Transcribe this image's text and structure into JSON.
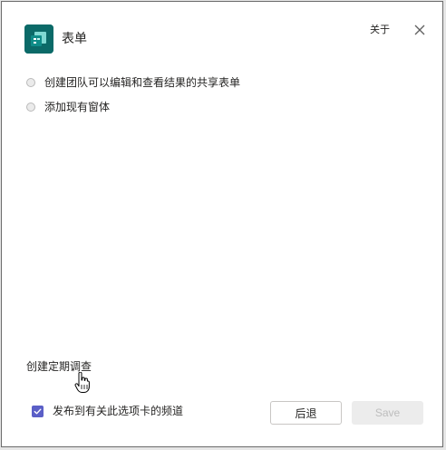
{
  "header": {
    "app_name": "表单",
    "about_label": "关于"
  },
  "options": [
    {
      "label": "创建团队可以编辑和查看结果的共享表单"
    },
    {
      "label": "添加现有窗体"
    }
  ],
  "create_survey_label": "创建定期调查",
  "publish_checkbox": {
    "label": "发布到有关此选项卡的频道",
    "checked": true
  },
  "buttons": {
    "back_label": "后退",
    "save_label": "Save"
  },
  "colors": {
    "app_icon": "#0b6a68",
    "checkbox": "#5b5fc7"
  },
  "icons": {
    "app": "forms-app-icon",
    "close": "close-icon",
    "cursor": "hand-pointer-cursor-icon",
    "check": "checkmark-icon"
  }
}
